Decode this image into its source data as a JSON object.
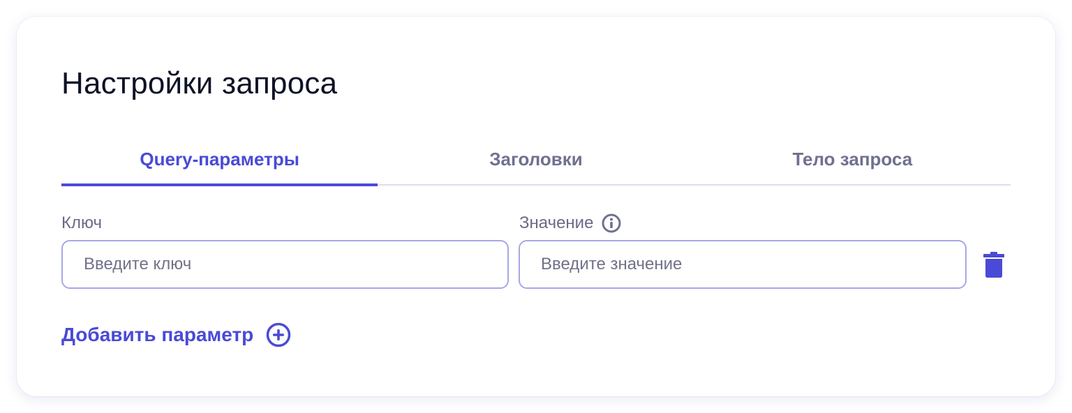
{
  "card": {
    "title": "Настройки запроса"
  },
  "tabs": [
    {
      "label": "Query-параметры",
      "active": true
    },
    {
      "label": "Заголовки",
      "active": false
    },
    {
      "label": "Тело запроса",
      "active": false
    }
  ],
  "params": {
    "key_label": "Ключ",
    "value_label": "Значение",
    "key_placeholder": "Введите ключ",
    "value_placeholder": "Введите значение",
    "key_value": "",
    "value_value": "",
    "info_icon": "info-icon",
    "delete_icon": "trash-icon"
  },
  "actions": {
    "add_param_label": "Добавить параметр",
    "add_icon": "plus-circle-icon"
  },
  "colors": {
    "accent": "#4a4ad6",
    "title": "#0d1226",
    "muted_text": "#707090",
    "input_border": "#a6a7e6",
    "tab_divider": "#dddcef"
  }
}
